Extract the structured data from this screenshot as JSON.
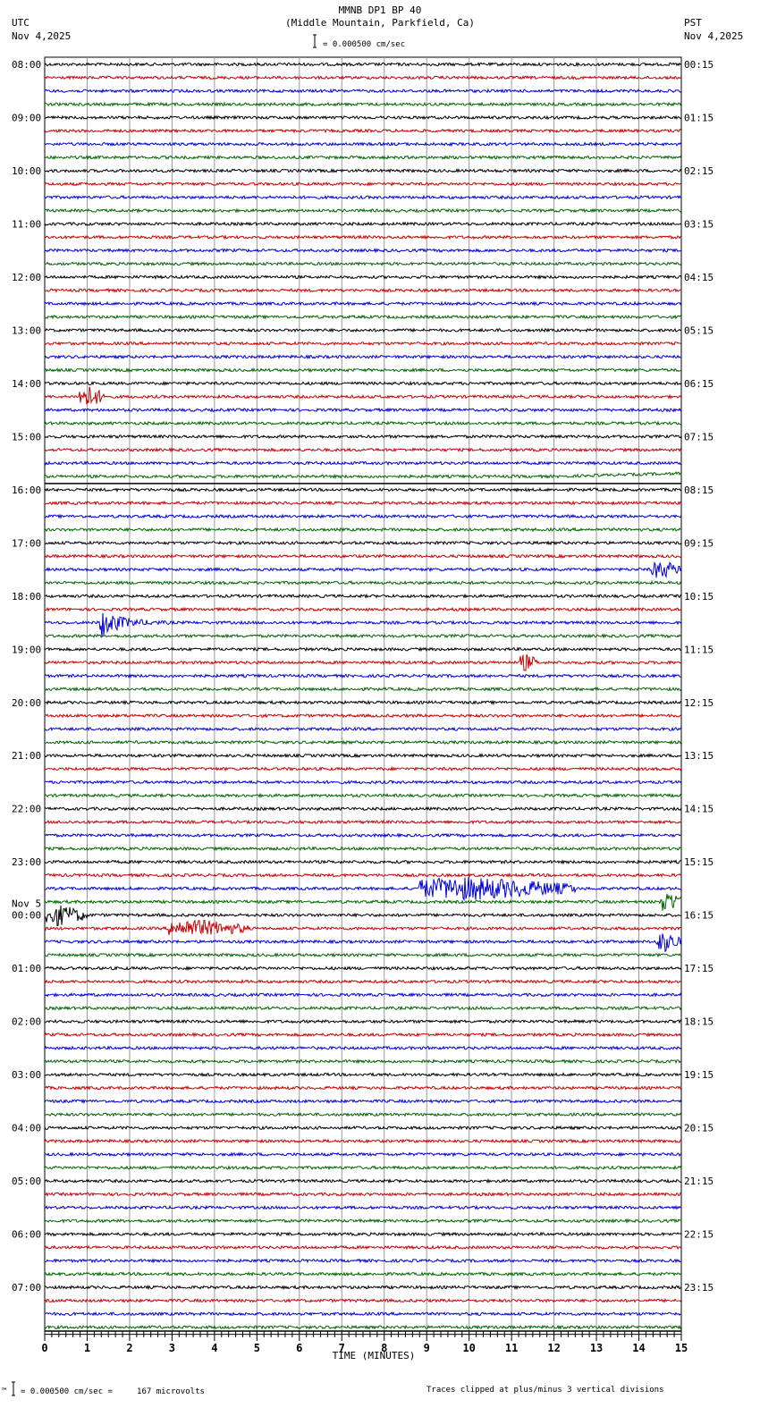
{
  "header": {
    "title": "MMNB DP1 BP 40",
    "subtitle": "(Middle Mountain, Parkfield, Ca)",
    "left_tz": "UTC",
    "left_date": "Nov 4,2025",
    "right_tz": "PST",
    "right_date": "Nov 4,2025",
    "scale_label": "= 0.000500 cm/sec"
  },
  "footer": {
    "scale_label": "= 0.000500 cm/sec =     167 microvolts",
    "clip_note": "Traces clipped at plus/minus 3 vertical divisions"
  },
  "chart_data": {
    "type": "line",
    "title": "MMNB DP1 BP 40",
    "xlabel": "TIME (MINUTES)",
    "xlim": [
      0,
      15
    ],
    "x_ticks": [
      "0",
      "1",
      "2",
      "3",
      "4",
      "5",
      "6",
      "7",
      "8",
      "9",
      "10",
      "11",
      "12",
      "13",
      "14",
      "15"
    ],
    "rows_per_hour": 4,
    "trace_colors": [
      "#000000",
      "#cc0000",
      "#0000dd",
      "#006600"
    ],
    "left_labels": [
      "08:00",
      "09:00",
      "10:00",
      "11:00",
      "12:00",
      "13:00",
      "14:00",
      "15:00",
      "16:00",
      "17:00",
      "18:00",
      "19:00",
      "20:00",
      "21:00",
      "22:00",
      "23:00",
      "00:00",
      "01:00",
      "02:00",
      "03:00",
      "04:00",
      "05:00",
      "06:00",
      "07:00"
    ],
    "day_change_label": "Nov 5",
    "day_change_index": 16,
    "right_labels": [
      "00:15",
      "01:15",
      "02:15",
      "03:15",
      "04:15",
      "05:15",
      "06:15",
      "07:15",
      "08:15",
      "09:15",
      "10:15",
      "11:15",
      "12:15",
      "13:15",
      "14:15",
      "15:15",
      "16:15",
      "17:15",
      "18:15",
      "19:15",
      "20:15",
      "21:15",
      "22:15",
      "23:15"
    ],
    "events": [
      {
        "row": 25,
        "start_min": 0.8,
        "end_min": 1.4,
        "amplitude": 2
      },
      {
        "row": 31,
        "start_min": 12.0,
        "end_min": 15.0,
        "amplitude": 1.2
      },
      {
        "row": 38,
        "start_min": 14.3,
        "end_min": 15.0,
        "amplitude": 1.5
      },
      {
        "row": 42,
        "start_min": 1.3,
        "end_min": 3.0,
        "amplitude": 3
      },
      {
        "row": 45,
        "start_min": 11.2,
        "end_min": 11.6,
        "amplitude": 1.5
      },
      {
        "row": 62,
        "start_min": 8.8,
        "end_min": 12.5,
        "amplitude": 2
      },
      {
        "row": 63,
        "start_min": 14.5,
        "end_min": 15.0,
        "amplitude": 2
      },
      {
        "row": 64,
        "start_min": 0.0,
        "end_min": 1.0,
        "amplitude": 1.8
      },
      {
        "row": 65,
        "start_min": 2.9,
        "end_min": 4.8,
        "amplitude": 1.5
      },
      {
        "row": 66,
        "start_min": 14.4,
        "end_min": 15.0,
        "amplitude": 1.8
      }
    ]
  }
}
